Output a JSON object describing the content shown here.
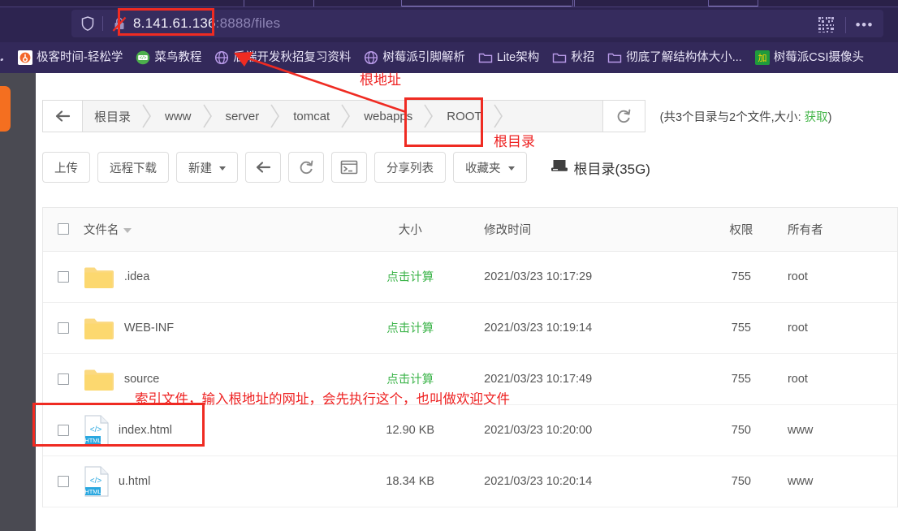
{
  "browser": {
    "url_host": "8.141.61.136",
    "url_rest": ":8888/files",
    "shield_icon": "shield-icon",
    "lock_icon": "lock-crossed-icon",
    "qr_icon": "qr-code-icon",
    "menu_icon": "more-options-icon",
    "bookmarks": [
      {
        "label": "极客时间-轻松学",
        "icon": "geektime-favicon"
      },
      {
        "label": "菜鸟教程",
        "icon": "runoob-favicon"
      },
      {
        "label": "后端开发秋招复习资料",
        "icon": "globe-icon"
      },
      {
        "label": "树莓派引脚解析",
        "icon": "globe-icon"
      },
      {
        "label": "Lite架构",
        "icon": "folder-icon"
      },
      {
        "label": "秋招",
        "icon": "folder-icon"
      },
      {
        "label": "彻底了解结构体大小...",
        "icon": "folder-icon"
      },
      {
        "label": "树莓派CSI摄像头",
        "icon": "csi-favicon"
      }
    ]
  },
  "breadcrumb": {
    "back_icon": "back-arrow-icon",
    "refresh_icon": "refresh-icon",
    "items": [
      "根目录",
      "www",
      "server",
      "tomcat",
      "webapps",
      "ROOT"
    ],
    "info_prefix": "(共3个目录与2个文件,大小: ",
    "info_link": "获取",
    "info_suffix": ")"
  },
  "toolbar": {
    "upload": "上传",
    "remote_download": "远程下载",
    "new": "新建",
    "back_icon": "back-arrow-icon",
    "refresh_icon": "refresh-icon",
    "terminal_icon": "terminal-icon",
    "share_list": "分享列表",
    "favorites": "收藏夹",
    "disk_icon": "disk-icon",
    "disk_label": "根目录(35G)"
  },
  "table": {
    "headers": {
      "select_all": "select-all-checkbox",
      "name": "文件名",
      "size": "大小",
      "mtime": "修改时间",
      "perm": "权限",
      "owner": "所有者"
    },
    "rows": [
      {
        "icon": "folder-icon",
        "name": ".idea",
        "size": "点击计算",
        "size_is_link": true,
        "mtime": "2021/03/23 10:17:29",
        "perm": "755",
        "owner": "root"
      },
      {
        "icon": "folder-icon",
        "name": "WEB-INF",
        "size": "点击计算",
        "size_is_link": true,
        "mtime": "2021/03/23 10:19:14",
        "perm": "755",
        "owner": "root"
      },
      {
        "icon": "folder-icon",
        "name": "source",
        "size": "点击计算",
        "size_is_link": true,
        "mtime": "2021/03/23 10:17:49",
        "perm": "755",
        "owner": "root"
      },
      {
        "icon": "html-icon",
        "name": "index.html",
        "size": "12.90 KB",
        "size_is_link": false,
        "mtime": "2021/03/23 10:20:00",
        "perm": "750",
        "owner": "www"
      },
      {
        "icon": "html-icon",
        "name": "u.html",
        "size": "18.34 KB",
        "size_is_link": false,
        "mtime": "2021/03/23 10:20:14",
        "perm": "750",
        "owner": "www"
      }
    ]
  },
  "annotations": {
    "root_address": "根地址",
    "root_directory": "根目录",
    "index_note": "索引文件，输入根地址的网址，会先执行这个，也叫做欢迎文件",
    "color": "#ee2222"
  }
}
